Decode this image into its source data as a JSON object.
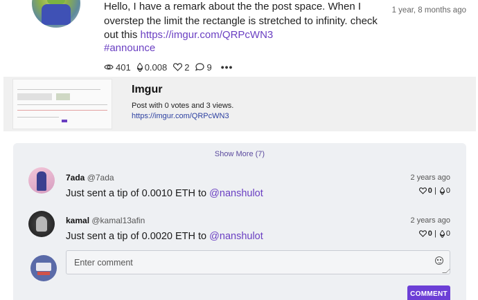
{
  "post": {
    "text_before_link": "Hello, I have a remark about the the post space. When I overstep the limit the rectangle is stretched to infinity. check out this ",
    "link": "https://imgur.com/QRPcWN3",
    "hashtag": "#announce",
    "time": "1 year, 8 months ago",
    "stats": {
      "views": "401",
      "eth": "0.008",
      "likes": "2",
      "comments": "9"
    }
  },
  "preview": {
    "title": "Imgur",
    "description": "Post with 0 votes and 3 views.",
    "url": "https://imgur.com/QRPcWN3"
  },
  "comments": {
    "show_more": "Show More (7)",
    "items": [
      {
        "name": "7ada",
        "handle": "@7ada",
        "time": "2 years ago",
        "body_prefix": "Just sent a tip of 0.0010 ETH to ",
        "mention": "@nanshulot",
        "likes": "0",
        "tips": "0"
      },
      {
        "name": "kamal",
        "handle": "@kamal13afin",
        "time": "2 years ago",
        "body_prefix": "Just sent a tip of 0.0020 ETH to ",
        "mention": "@nanshulot",
        "likes": "0",
        "tips": "0"
      }
    ],
    "input_placeholder": "Enter comment",
    "submit_label": "COMMENT"
  },
  "icons": {
    "views": "eye-icon",
    "eth": "ethereum-icon",
    "likes": "heart-icon",
    "comments": "chat-bubble-icon",
    "more": "more-dots-icon"
  },
  "colors": {
    "accent": "#6c3fd6",
    "link": "#6a3fc2"
  }
}
